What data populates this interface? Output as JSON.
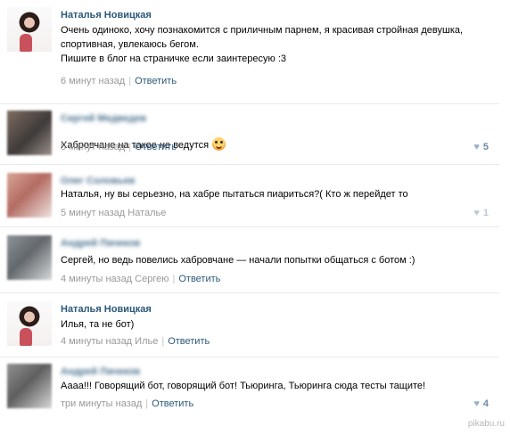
{
  "comments": [
    {
      "author": "Наталья Новицкая",
      "text": "Очень одиноко, хочу познакомится с приличным парнем, я красивая стройная девушка,\nспортивная, увлекаюсь бегом.\nПишите в блог на страничке если заинтересую :3",
      "meta_time": "6 минут назад",
      "reply_label": "Ответить"
    },
    {
      "author": "Сергей Медведев",
      "text": "Хабровчане на такое не ведутся",
      "meta_time": "5 минут назад",
      "reply_label": "Ответить",
      "likes": "5"
    },
    {
      "author": "Олег Соловьев",
      "text": "Наталья, ну вы серьезно, на хабре пытаться пиариться?( Кто ж перейдет то",
      "meta_time": "5 минут назад Наталье",
      "likes": "1"
    },
    {
      "author": "Андрей Пачеков",
      "text": "Сергей, но ведь повелись хабровчане — начали попытки общаться с ботом :)",
      "meta_time": "4 минуты назад Сергею",
      "reply_label": "Ответить"
    },
    {
      "author": "Наталья Новицкая",
      "text": "Илья, та не бот)",
      "meta_time": "4 минуты назад Илье",
      "reply_label": "Ответить"
    },
    {
      "author": "Андрей Пачеков",
      "text": "Аааа!!! Говорящий бот, говорящий бот! Тьюринга, Тьюринга сюда тесты тащите!",
      "meta_time": "три минуты назад",
      "reply_label": "Ответить",
      "likes": "4"
    }
  ],
  "watermark": "pikabu.ru",
  "icons": {
    "emoji": "grinning-face-icon",
    "like": "heart-icon"
  },
  "colors": {
    "author_link": "#2b587a",
    "meta_text": "#999999",
    "divider": "#e7eaed",
    "heart": "#9bb0c7"
  }
}
